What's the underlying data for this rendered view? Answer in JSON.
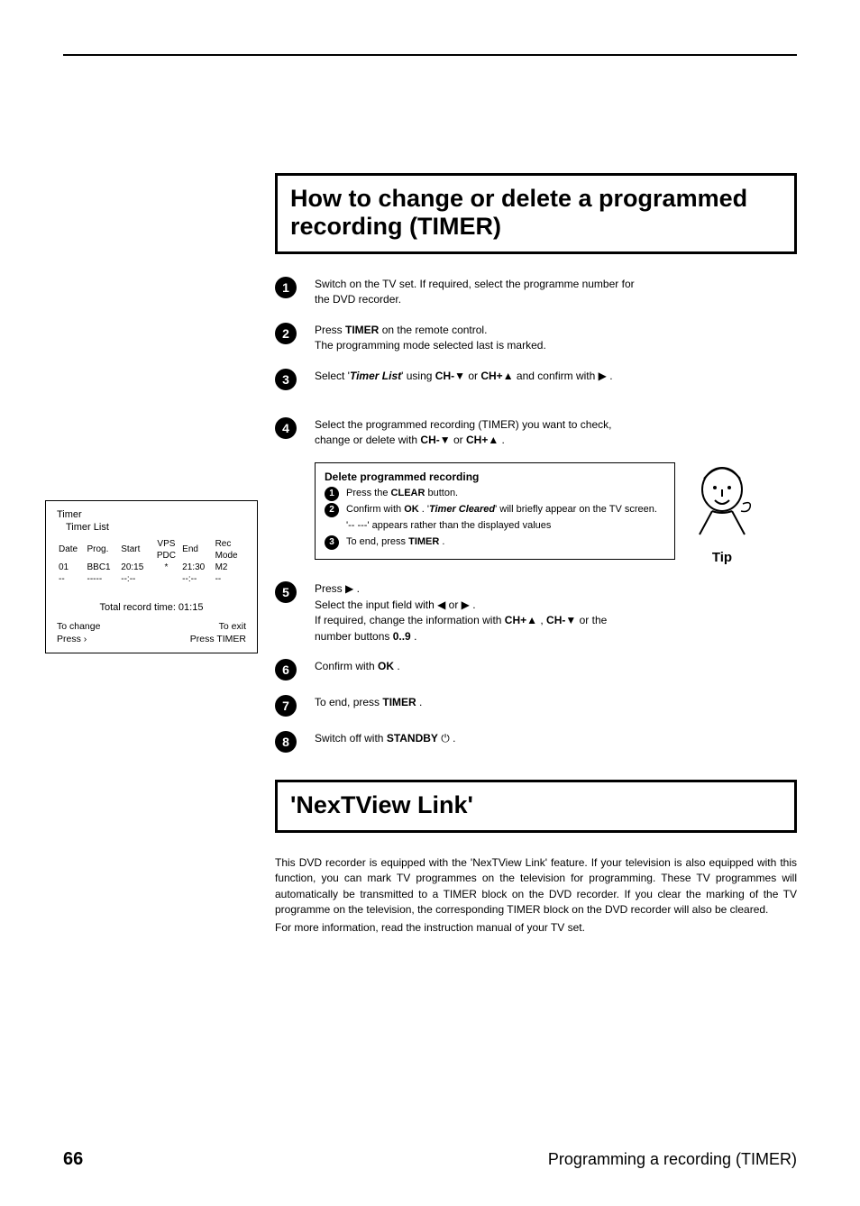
{
  "heading1": "How to change or delete a programmed recording (TIMER)",
  "steps": {
    "s1": "Switch on the TV set. If required, select the programme number for the DVD recorder.",
    "s2a": "Press ",
    "s2_btn": "TIMER",
    "s2b": " on the remote control.",
    "s2c": "The programming mode selected last is marked.",
    "s3a": "Select '",
    "s3_i": "Timer List",
    "s3b": "' using ",
    "s3_ch1": "CH-",
    "s3_or": " or ",
    "s3_ch2": "CH+",
    "s3_conf": " and confirm with ",
    "s4a": "Select the programmed recording (TIMER) you want to check, change or delete with ",
    "s4_ch1": "CH-",
    "s4_or": " or ",
    "s4_ch2": "CH+",
    "s5a": "Press ",
    "s5b": "Select the input field with ",
    "s5_or": " or ",
    "s5c": "If required, change the information with ",
    "s5_ch1": "CH+",
    "s5_c2": " , ",
    "s5_ch2": "CH-",
    "s5_c3": " or the number buttons ",
    "s5_num": "0..9",
    "s6a": "Confirm with ",
    "s6_btn": "OK",
    "s7a": "To end, press ",
    "s7_btn": "TIMER",
    "s8a": "Switch off with ",
    "s8_btn": "STANDBY"
  },
  "tipbox": {
    "title": "Delete programmed recording",
    "l1a": "Press the ",
    "l1_btn": "CLEAR",
    "l1b": " button.",
    "l2a": "Confirm with ",
    "l2_btn": "OK",
    "l2b": " . '",
    "l2_i": "Timer Cleared",
    "l2c": "' will briefly appear on the TV screen.",
    "l2d": "'-- ---' appears rather than the displayed values",
    "l3a": "To end, press ",
    "l3_btn": "TIMER",
    "tip_label": "Tip"
  },
  "timer_panel": {
    "title": "Timer",
    "subtitle": "Timer List",
    "cols": [
      "Date",
      "Prog.",
      "Start",
      "VPS\nPDC",
      "End",
      "Rec\nMode"
    ],
    "row": [
      "01",
      "BBC1",
      "20:15",
      "*",
      "21:30",
      "M2"
    ],
    "blank": [
      "--",
      "-----",
      "--:--",
      "",
      "--:--",
      "--"
    ],
    "total": "Total record time: 01:15",
    "left1": "To change",
    "left2": "Press ›",
    "right1": "To exit",
    "right2": "Press TIMER"
  },
  "heading2": "'NexTView Link'",
  "nextview_body": "This DVD recorder is equipped with the 'NexTView Link' feature. If your television is also equipped with this function, you can mark TV programmes on the television for programming. These TV programmes will automatically be transmitted to a TIMER block on the DVD recorder. If you clear the marking of the TV programme on the television, the corresponding TIMER block on the DVD recorder will also be cleared.",
  "nextview_more": "For more information, read the instruction manual of your TV set.",
  "footer": {
    "page": "66",
    "section": "Programming a recording (TIMER)"
  },
  "glyphs": {
    "down": "▼",
    "up": "▲",
    "left": "◀",
    "right": "▶",
    "power": "⏻",
    "dot": " ."
  }
}
